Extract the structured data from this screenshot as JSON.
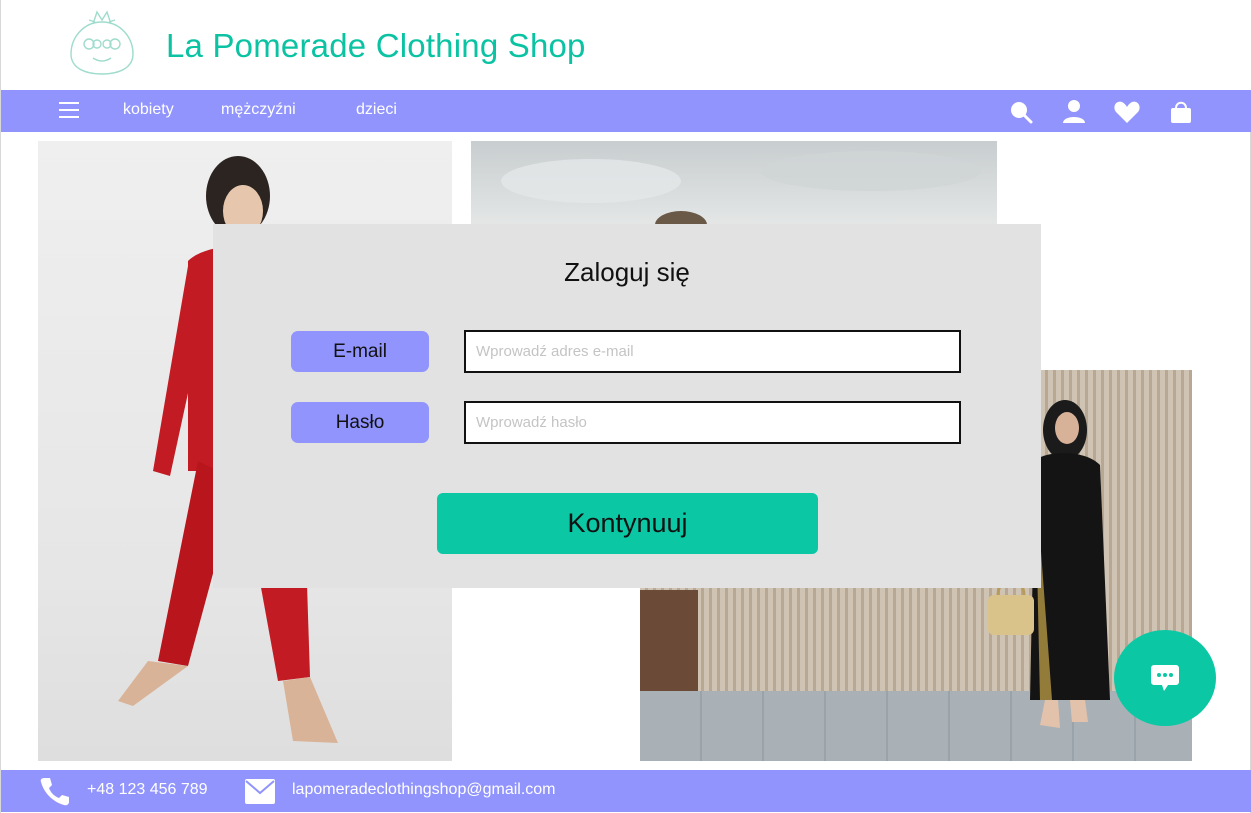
{
  "header": {
    "logo_icon": "pomegranate-logo-icon",
    "title": "La Pomerade Clothing Shop"
  },
  "nav": {
    "menu_icon": "hamburger-menu-icon",
    "links": [
      "kobiety",
      "mężczyźni",
      "dzieci"
    ],
    "icons": [
      "search-icon",
      "user-icon",
      "heart-icon",
      "shopping-bag-icon"
    ]
  },
  "login_modal": {
    "title": "Zaloguj się",
    "email": {
      "label": "E-mail",
      "placeholder": "Wprowadź adres e-mail",
      "value": ""
    },
    "password": {
      "label": "Hasło",
      "placeholder": "Wprowadź hasło",
      "value": ""
    },
    "submit_label": "Kontynuuj"
  },
  "chat": {
    "icon": "chat-bubble-icon"
  },
  "footer": {
    "phone_icon": "phone-icon",
    "phone": "+48 123 456 789",
    "email_icon": "envelope-icon",
    "email": "lapomeradeclothingshop@gmail.com"
  },
  "colors": {
    "accent_purple": "#9194fc",
    "accent_teal": "#0bc7a4",
    "modal_bg": "#e2e2e2"
  }
}
